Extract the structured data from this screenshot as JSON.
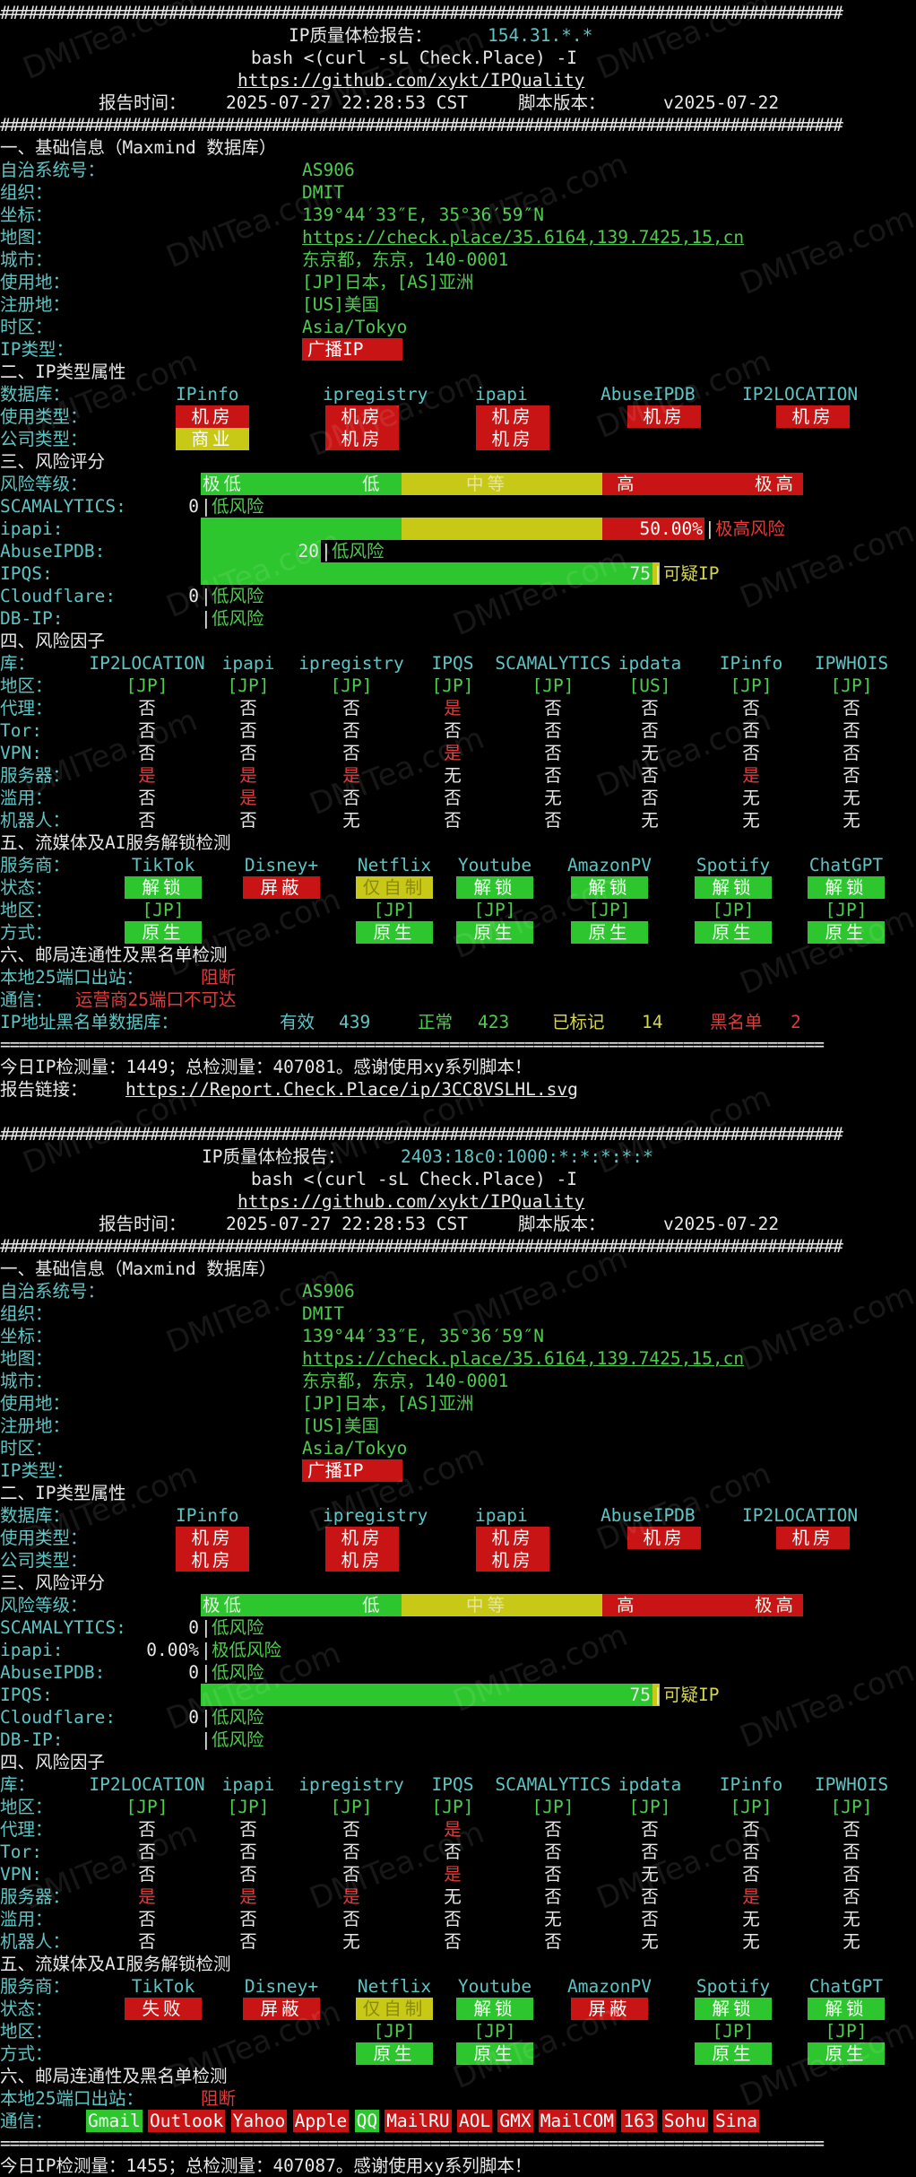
{
  "watermark": "DMITea.com",
  "hashline": "##########################################################################################",
  "eqline": "========================================================================================",
  "reports": [
    {
      "header": {
        "title_label": "IP质量体检报告：",
        "ip": "154.31.*.*",
        "cmd": "bash <(curl -sL Check.Place) -I",
        "repo": "https://github.com/xykt/IPQuality",
        "time_label": "报告时间：",
        "time": "2025-07-27 22:28:53 CST",
        "ver_label": "脚本版本：",
        "ver": "v2025-07-22"
      },
      "basic": {
        "title": "一、基础信息（Maxmind 数据库）",
        "asn_l": "自治系统号：",
        "asn": "AS906",
        "org_l": "组织：",
        "org": "DMIT",
        "coord_l": "坐标：",
        "coord": "139°44′33″E, 35°36′59″N",
        "map_l": "地图：",
        "map": "https://check.place/35.6164,139.7425,15,cn",
        "city_l": "城市：",
        "city": "东京都，东京，140-0001",
        "use_l": "使用地：",
        "use": "[JP]日本，[AS]亚洲",
        "reg_l": "注册地：",
        "reg": "[US]美国",
        "tz_l": "时区：",
        "tz": "Asia/Tokyo",
        "type_l": "IP类型：",
        "type": "广播IP"
      },
      "attr": {
        "title": "二、IP类型属性",
        "db_l": "数据库：",
        "dbs": [
          "IPinfo",
          "ipregistry",
          "ipapi",
          "AbuseIPDB",
          "IP2LOCATION"
        ],
        "usage_l": "使用类型：",
        "usage": [
          "机房",
          "机房",
          "机房",
          "机房",
          "机房"
        ],
        "company_l": "公司类型：",
        "company": [
          "商业",
          "机房",
          "机房",
          "",
          ""
        ]
      },
      "risk": {
        "title": "三、风险评分",
        "level_l": "风险等级：",
        "levels": [
          "极低",
          "低",
          "中等",
          "高",
          "极高"
        ],
        "scam_l": "SCAMALYTICS:",
        "scam": "0",
        "scam_t": "低风险",
        "ipapi_l": "ipapi:",
        "ipapi": "50.00%",
        "ipapi_t": "极高风险",
        "ipapi_frac": 0.5,
        "abuse_l": "AbuseIPDB:",
        "abuse": "20",
        "abuse_t": "低风险",
        "abuse_frac": 0.2,
        "ipqs_l": "IPQS:",
        "ipqs": "75",
        "ipqs_t": "可疑IP",
        "ipqs_frac": 0.75,
        "cf_l": "Cloudflare:",
        "cf": "0",
        "cf_t": "低风险",
        "dbip_l": "DB-IP:",
        "dbip_t": "低风险"
      },
      "factor": {
        "title": "四、风险因子",
        "lib_l": "库：",
        "libs": [
          "IP2LOCATION",
          "ipapi",
          "ipregistry",
          "IPQS",
          "SCAMALYTICS",
          "ipdata",
          "IPinfo",
          "IPWHOIS"
        ],
        "rows": [
          {
            "l": "地区：",
            "v": [
              "[JP]",
              "[JP]",
              "[JP]",
              "[JP]",
              "[JP]",
              "[US]",
              "[JP]",
              "[JP]"
            ]
          },
          {
            "l": "代理：",
            "v": [
              "否",
              "否",
              "否",
              "是",
              "否",
              "否",
              "否",
              "否"
            ]
          },
          {
            "l": "Tor:",
            "v": [
              "否",
              "否",
              "否",
              "否",
              "否",
              "否",
              "否",
              "否"
            ]
          },
          {
            "l": "VPN:",
            "v": [
              "否",
              "否",
              "否",
              "是",
              "否",
              "无",
              "否",
              "否"
            ]
          },
          {
            "l": "服务器：",
            "v": [
              "是",
              "是",
              "是",
              "无",
              "否",
              "否",
              "是",
              "否"
            ]
          },
          {
            "l": "滥用：",
            "v": [
              "否",
              "是",
              "否",
              "否",
              "无",
              "否",
              "无",
              "无"
            ]
          },
          {
            "l": "机器人：",
            "v": [
              "否",
              "否",
              "无",
              "否",
              "否",
              "无",
              "无",
              "无"
            ]
          }
        ]
      },
      "stream": {
        "title": "五、流媒体及AI服务解锁检测",
        "svc_l": "服务商：",
        "svcs": [
          "TikTok",
          "Disney+",
          "Netflix",
          "Youtube",
          "AmazonPV",
          "Spotify",
          "ChatGPT"
        ],
        "status_l": "状态：",
        "status": [
          "解锁",
          "屏蔽",
          "仅自制",
          "解锁",
          "解锁",
          "解锁",
          "解锁"
        ],
        "region_l": "地区：",
        "region": [
          "[JP]",
          "",
          "[JP]",
          "[JP]",
          "[JP]",
          "[JP]",
          "[JP]"
        ],
        "mode_l": "方式：",
        "mode": [
          "原生",
          "",
          "原生",
          "原生",
          "原生",
          "原生",
          "原生"
        ]
      },
      "mail": {
        "title": "六、邮局连通性及黑名单检测",
        "port_l": "本地25端口出站：",
        "port": "阻断",
        "comm_l": "通信：",
        "comm_note": "运营商25端口不可达"
      },
      "blacklist": {
        "l": "IP地址黑名单数据库：",
        "valid_l": "有效",
        "valid": "439",
        "normal_l": "正常",
        "normal": "423",
        "marked_l": "已标记",
        "marked": "14",
        "black_l": "黑名单",
        "black": "2"
      },
      "footer": {
        "count": "今日IP检测量：1449；总检测量：407081。感谢使用xy系列脚本！",
        "link_l": "报告链接：",
        "link": "https://Report.Check.Place/ip/3CC8VSLHL.svg"
      }
    },
    {
      "header": {
        "title_label": "IP质量体检报告：",
        "ip": "2403:18c0:1000:*:*:*:*:*",
        "cmd": "bash <(curl -sL Check.Place) -I",
        "repo": "https://github.com/xykt/IPQuality",
        "time_label": "报告时间：",
        "time": "2025-07-27 22:28:53 CST",
        "ver_label": "脚本版本：",
        "ver": "v2025-07-22"
      },
      "basic": {
        "title": "一、基础信息（Maxmind 数据库）",
        "asn_l": "自治系统号：",
        "asn": "AS906",
        "org_l": "组织：",
        "org": "DMIT",
        "coord_l": "坐标：",
        "coord": "139°44′33″E, 35°36′59″N",
        "map_l": "地图：",
        "map": "https://check.place/35.6164,139.7425,15,cn",
        "city_l": "城市：",
        "city": "东京都，东京，140-0001",
        "use_l": "使用地：",
        "use": "[JP]日本，[AS]亚洲",
        "reg_l": "注册地：",
        "reg": "[US]美国",
        "tz_l": "时区：",
        "tz": "Asia/Tokyo",
        "type_l": "IP类型：",
        "type": "广播IP"
      },
      "attr": {
        "title": "二、IP类型属性",
        "db_l": "数据库：",
        "dbs": [
          "IPinfo",
          "ipregistry",
          "ipapi",
          "AbuseIPDB",
          "IP2LOCATION"
        ],
        "usage_l": "使用类型：",
        "usage": [
          "机房",
          "机房",
          "机房",
          "机房",
          "机房"
        ],
        "company_l": "公司类型：",
        "company": [
          "机房",
          "机房",
          "机房",
          "",
          ""
        ]
      },
      "risk": {
        "title": "三、风险评分",
        "level_l": "风险等级：",
        "levels": [
          "极低",
          "低",
          "中等",
          "高",
          "极高"
        ],
        "scam_l": "SCAMALYTICS:",
        "scam": "0",
        "scam_t": "低风险",
        "ipapi_l": "ipapi:",
        "ipapi": "0.00%",
        "ipapi_t": "极低风险",
        "ipapi_frac": 0,
        "abuse_l": "AbuseIPDB:",
        "abuse": "0",
        "abuse_t": "低风险",
        "abuse_frac": 0,
        "ipqs_l": "IPQS:",
        "ipqs": "75",
        "ipqs_t": "可疑IP",
        "ipqs_frac": 0.75,
        "cf_l": "Cloudflare:",
        "cf": "0",
        "cf_t": "低风险",
        "dbip_l": "DB-IP:",
        "dbip_t": "低风险"
      },
      "factor": {
        "title": "四、风险因子",
        "lib_l": "库：",
        "libs": [
          "IP2LOCATION",
          "ipapi",
          "ipregistry",
          "IPQS",
          "SCAMALYTICS",
          "ipdata",
          "IPinfo",
          "IPWHOIS"
        ],
        "rows": [
          {
            "l": "地区：",
            "v": [
              "[JP]",
              "[JP]",
              "[JP]",
              "[JP]",
              "[JP]",
              "[JP]",
              "[JP]",
              "[JP]"
            ]
          },
          {
            "l": "代理：",
            "v": [
              "否",
              "否",
              "否",
              "是",
              "否",
              "否",
              "否",
              "否"
            ]
          },
          {
            "l": "Tor:",
            "v": [
              "否",
              "否",
              "否",
              "否",
              "否",
              "否",
              "否",
              "否"
            ]
          },
          {
            "l": "VPN:",
            "v": [
              "否",
              "否",
              "否",
              "是",
              "否",
              "无",
              "否",
              "否"
            ]
          },
          {
            "l": "服务器：",
            "v": [
              "是",
              "是",
              "是",
              "无",
              "否",
              "否",
              "是",
              "否"
            ]
          },
          {
            "l": "滥用：",
            "v": [
              "否",
              "否",
              "否",
              "否",
              "无",
              "否",
              "无",
              "无"
            ]
          },
          {
            "l": "机器人：",
            "v": [
              "否",
              "否",
              "无",
              "否",
              "否",
              "无",
              "无",
              "无"
            ]
          }
        ]
      },
      "stream": {
        "title": "五、流媒体及AI服务解锁检测",
        "svc_l": "服务商：",
        "svcs": [
          "TikTok",
          "Disney+",
          "Netflix",
          "Youtube",
          "AmazonPV",
          "Spotify",
          "ChatGPT"
        ],
        "status_l": "状态：",
        "status": [
          "失败",
          "屏蔽",
          "仅自制",
          "解锁",
          "屏蔽",
          "解锁",
          "解锁"
        ],
        "region_l": "地区：",
        "region": [
          "",
          "",
          "[JP]",
          "[JP]",
          "",
          "[JP]",
          "[JP]"
        ],
        "mode_l": "方式：",
        "mode": [
          "",
          "",
          "原生",
          "原生",
          "",
          "原生",
          "原生"
        ]
      },
      "mail": {
        "title": "六、邮局连通性及黑名单检测",
        "port_l": "本地25端口出站：",
        "port": "阻断",
        "comm_l": "通信：",
        "providers": [
          "Gmail",
          "Outlook",
          "Yahoo",
          "Apple",
          "QQ",
          "MailRU",
          "AOL",
          "GMX",
          "MailCOM",
          "163",
          "Sohu",
          "Sina"
        ],
        "provider_ok": [
          true,
          false,
          false,
          false,
          true,
          false,
          false,
          false,
          false,
          false,
          false,
          false
        ]
      },
      "footer": {
        "count": "今日IP检测量：1455；总检测量：407087。感谢使用xy系列脚本！"
      }
    }
  ],
  "colors": {
    "cyan": "#5fc4c4",
    "green": "#4ecb4e",
    "yellow": "#d6d64a",
    "red": "#e03a3a",
    "bg_red": "#c81414",
    "bg_green": "#2ec62e",
    "bg_yellow": "#c8c816"
  }
}
